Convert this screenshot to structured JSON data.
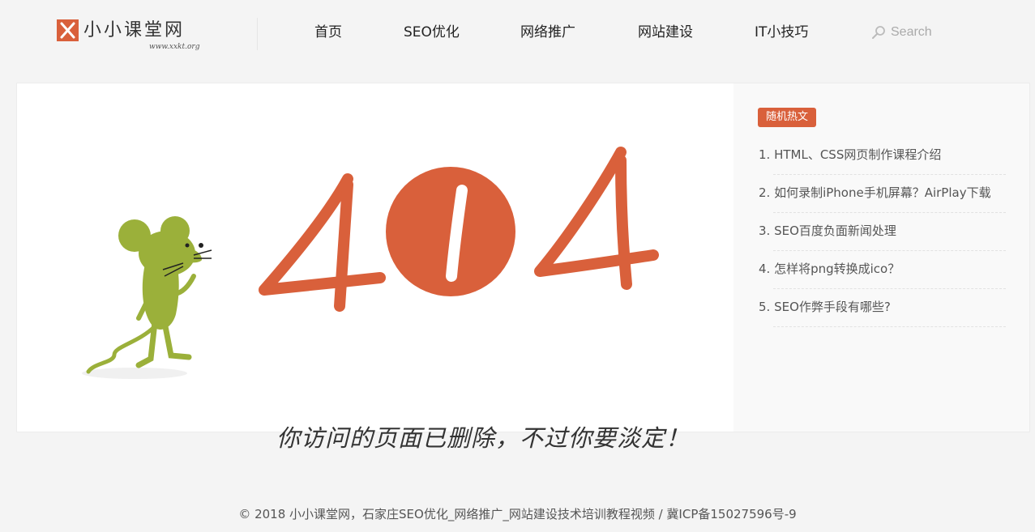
{
  "site": {
    "logo_text": "小小课堂网",
    "logo_url": "www.xxkt.org",
    "brand_color": "#d9603b"
  },
  "nav": {
    "items": [
      {
        "label": "首页"
      },
      {
        "label": "SEO优化"
      },
      {
        "label": "网络推广"
      },
      {
        "label": "网站建设"
      },
      {
        "label": "IT小技巧"
      }
    ]
  },
  "search": {
    "placeholder": "Search",
    "icon": "search-icon"
  },
  "error": {
    "code": "404",
    "message": "你访问的页面已删除，不过你要淡定！",
    "illustration": "mouse-illustration"
  },
  "sidebar": {
    "badge": "随机热文",
    "items": [
      {
        "label": "1. HTML、CSS网页制作课程介绍"
      },
      {
        "label": "2. 如何录制iPhone手机屏幕？AirPlay下载"
      },
      {
        "label": "3. SEO百度负面新闻处理"
      },
      {
        "label": "4. 怎样将png转换成ico？"
      },
      {
        "label": "5. SEO作弊手段有哪些?"
      }
    ]
  },
  "footer": {
    "text": "© 2018 小小课堂网，石家庄SEO优化_网络推广_网站建设技术培训教程视频 / 冀ICP备15027596号-9"
  }
}
